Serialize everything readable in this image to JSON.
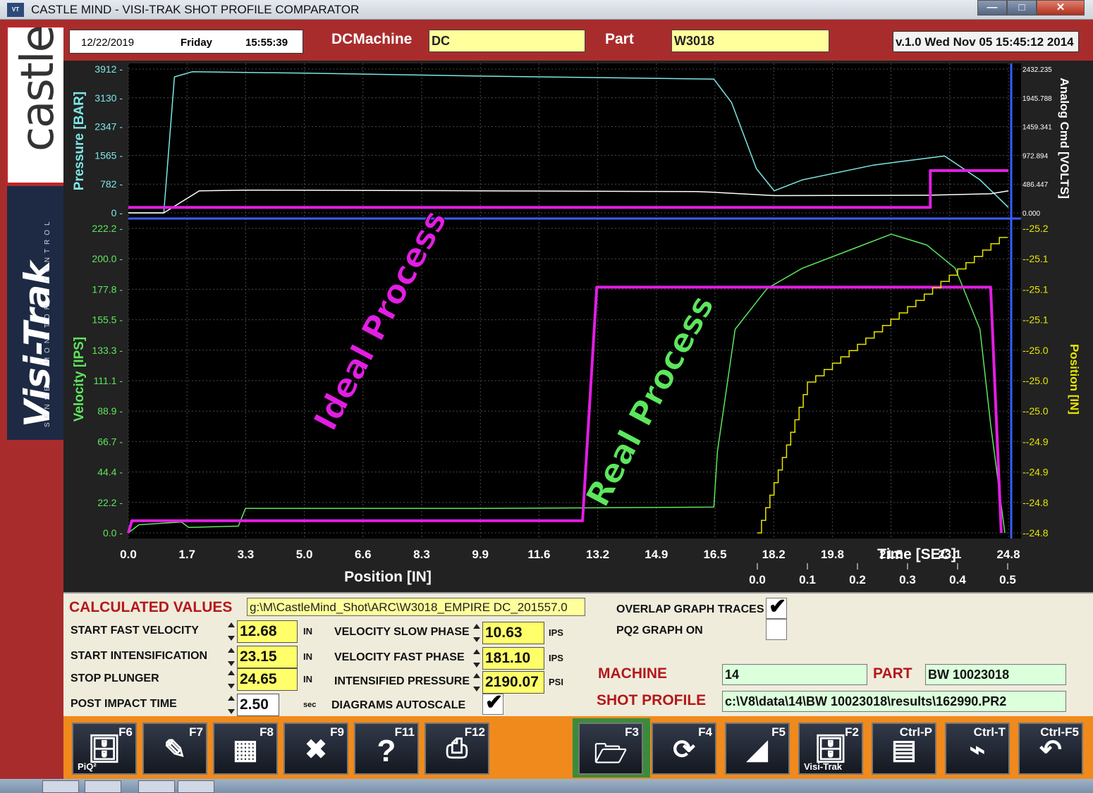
{
  "window": {
    "title": "CASTLE MIND - VISI-TRAK SHOT PROFILE COMPARATOR",
    "icon_name": "visitrak-app-icon",
    "minimize_label": "—",
    "maximize_label": "□",
    "close_label": "✕"
  },
  "branding": {
    "castle_logo_text": "castle",
    "visitrak_logo_text": "Visi-Trak",
    "visitrak_tagline": "SENSE · MONITOR · CONTROL"
  },
  "header": {
    "date": "12/22/2019",
    "day": "Friday",
    "time": "15:55:39",
    "machine_label": "DCMachine",
    "machine_value": "DC",
    "part_label": "Part",
    "part_value": "W3018",
    "version": "v.1.0 Wed Nov 05 15:45:12 2014"
  },
  "chart_data": [
    {
      "type": "line",
      "title": "",
      "ylabel": "Pressure [BAR]",
      "y2label": "Analog Cmd [VOLTS]",
      "yticks": [
        "3912",
        "3130",
        "2347",
        "1565",
        "782",
        "0"
      ],
      "y2ticks": [
        "2432.235",
        "1945.788",
        "1459.341",
        "972.894",
        "486.447",
        "0.000"
      ],
      "ylim": [
        0,
        3912
      ],
      "y2lim": [
        0,
        2432.235
      ],
      "grid": true,
      "series": [
        {
          "color": "#7fe6e6",
          "x": [
            0.0,
            1.0,
            1.3,
            1.8,
            3.3,
            5.0,
            10.0,
            16.5,
            17.0,
            17.7,
            18.2,
            19.0,
            21.0,
            23.0,
            24.0,
            24.8
          ],
          "y": [
            0,
            0,
            3700,
            3840,
            3820,
            3800,
            3720,
            3640,
            3000,
            1200,
            600,
            900,
            1300,
            1550,
            900,
            150
          ]
        },
        {
          "color": "#ffffff",
          "x": [
            0.0,
            1.0,
            2.0,
            3.3,
            5.0,
            10.0,
            16.0,
            16.5,
            18.2,
            22.5,
            24.3,
            24.8
          ],
          "y": [
            0,
            0,
            600,
            620,
            615,
            600,
            580,
            560,
            470,
            480,
            520,
            600
          ]
        },
        {
          "color": "#e21ee2",
          "x": [
            0.0,
            22.6,
            22.6,
            24.8
          ],
          "y": [
            150,
            150,
            1150,
            1150
          ]
        }
      ]
    },
    {
      "type": "line",
      "title": "",
      "xlabel": "Position [IN]",
      "ylabel": "Velocity [IPS]",
      "y2label": "Position [IN]",
      "xticks": [
        "0.0",
        "1.7",
        "3.3",
        "5.0",
        "6.6",
        "8.3",
        "9.9",
        "11.6",
        "13.2",
        "14.9",
        "16.5",
        "18.2",
        "19.8",
        "21.5",
        "23.1",
        "24.8"
      ],
      "yticks": [
        "222.2",
        "200.0",
        "177.8",
        "155.5",
        "133.3",
        "111.1",
        "88.9",
        "66.7",
        "44.4",
        "22.2",
        "0.0"
      ],
      "y2ticks": [
        "-25.2",
        "-25.1",
        "-25.1",
        "-25.1",
        "-25.0",
        "-25.0",
        "-25.0",
        "-24.9",
        "-24.9",
        "-24.8",
        "-24.8"
      ],
      "xlim": [
        0,
        24.8
      ],
      "ylim": [
        0,
        222.2
      ],
      "grid": true,
      "series": [
        {
          "name": "Real Process",
          "color": "#5de65d",
          "x": [
            0.0,
            0.3,
            1.5,
            1.7,
            3.1,
            3.3,
            10.0,
            16.5,
            16.6,
            17.1,
            18.0,
            19.0,
            20.5,
            21.5,
            22.5,
            23.3,
            24.0,
            24.3,
            24.7
          ],
          "y": [
            0,
            6,
            8,
            4,
            5,
            18,
            18,
            19,
            60,
            150,
            180,
            195,
            210,
            220,
            212,
            195,
            150,
            80,
            0
          ]
        },
        {
          "name": "Ideal Process",
          "color": "#e21ee2",
          "x": [
            0.0,
            0.1,
            12.8,
            13.2,
            24.3,
            24.6
          ],
          "y": [
            0,
            9,
            9,
            181,
            181,
            0
          ]
        }
      ]
    },
    {
      "type": "line",
      "xlabel": "Time [SEC]",
      "xticks": [
        "0.0",
        "0.1",
        "0.2",
        "0.3",
        "0.4",
        "0.5"
      ],
      "series": [
        {
          "color": "#e6e600",
          "x": [
            0.0,
            0.05,
            0.1,
            0.2,
            0.3,
            0.4,
            0.5
          ],
          "y": [
            -24.8,
            -24.9,
            -25.0,
            -25.05,
            -25.1,
            -25.15,
            -25.2
          ]
        }
      ]
    }
  ],
  "annotations": {
    "ideal_process": "Ideal Process",
    "real_process": "Real Process"
  },
  "calc": {
    "title": "CALCULATED VALUES",
    "file_path": "g:\\M\\CastleMind_Shot\\ARC\\W3018_EMPIRE DC_201557.0",
    "start_fast_velocity_label": "START FAST VELOCITY",
    "start_fast_velocity_value": "12.68",
    "start_fast_velocity_unit": "IN",
    "start_intensification_label": "START INTENSIFICATION",
    "start_intensification_value": "23.15",
    "start_intensification_unit": "IN",
    "stop_plunger_label": "STOP PLUNGER",
    "stop_plunger_value": "24.65",
    "stop_plunger_unit": "IN",
    "post_impact_time_label": "POST IMPACT TIME",
    "post_impact_time_value": "2.50",
    "post_impact_time_unit": "sec",
    "velocity_slow_phase_label": "VELOCITY SLOW PHASE",
    "velocity_slow_phase_value": "10.63",
    "velocity_slow_phase_unit": "IPS",
    "velocity_fast_phase_label": "VELOCITY FAST PHASE",
    "velocity_fast_phase_value": "181.10",
    "velocity_fast_phase_unit": "IPS",
    "intensified_pressure_label": "INTENSIFIED PRESSURE",
    "intensified_pressure_value": "2190.07",
    "intensified_pressure_unit": "PSI",
    "diagrams_autoscale_label": "DIAGRAMS AUTOSCALE",
    "diagrams_autoscale_checked": true,
    "overlap_graph_traces_label": "OVERLAP GRAPH TRACES",
    "overlap_graph_traces_checked": true,
    "pq2_graph_on_label": "PQ2 GRAPH ON",
    "pq2_graph_on_checked": false,
    "machine_label": "MACHINE",
    "machine_value": "14",
    "part_label": "PART",
    "part_value": "BW 10023018",
    "shot_profile_label": "SHOT PROFILE",
    "shot_profile_value": "c:\\V8\\data\\14\\BW 10023018\\results\\162990.PR2"
  },
  "toolbar": {
    "left": [
      {
        "key": "F6",
        "icon": "piq2-file-icon",
        "sub": "PiQ²"
      },
      {
        "key": "F7",
        "icon": "tools-icon",
        "sub": ""
      },
      {
        "key": "F8",
        "icon": "grid-scale-icon",
        "sub": ""
      },
      {
        "key": "F9",
        "icon": "delete-x-icon",
        "sub": ""
      },
      {
        "key": "F11",
        "icon": "help-icon",
        "sub": ""
      },
      {
        "key": "F12",
        "icon": "printer-icon",
        "sub": ""
      }
    ],
    "right": [
      {
        "key": "F3",
        "icon": "open-file-icon",
        "sub": ""
      },
      {
        "key": "F4",
        "icon": "refresh-icon",
        "sub": ""
      },
      {
        "key": "F5",
        "icon": "pq2-chart-icon",
        "sub": ""
      },
      {
        "key": "F2",
        "icon": "visitrak-file-icon",
        "sub": "Visi-Trak"
      },
      {
        "key": "Ctrl-P",
        "icon": "calculator-icon",
        "sub": ""
      },
      {
        "key": "Ctrl-T",
        "icon": "trend-chart-icon",
        "sub": ""
      },
      {
        "key": "Ctrl-F5",
        "icon": "back-arrow-icon",
        "sub": ""
      }
    ]
  },
  "colors": {
    "frame_red": "#a92c2c",
    "pressure_cyan": "#7fe6e6",
    "velocity_green": "#5de65d",
    "ideal_magenta": "#e21ee2",
    "position_yellow": "#e6e600",
    "cursor_blue": "#3a5cff",
    "toolbar_orange": "#f08a1c"
  }
}
